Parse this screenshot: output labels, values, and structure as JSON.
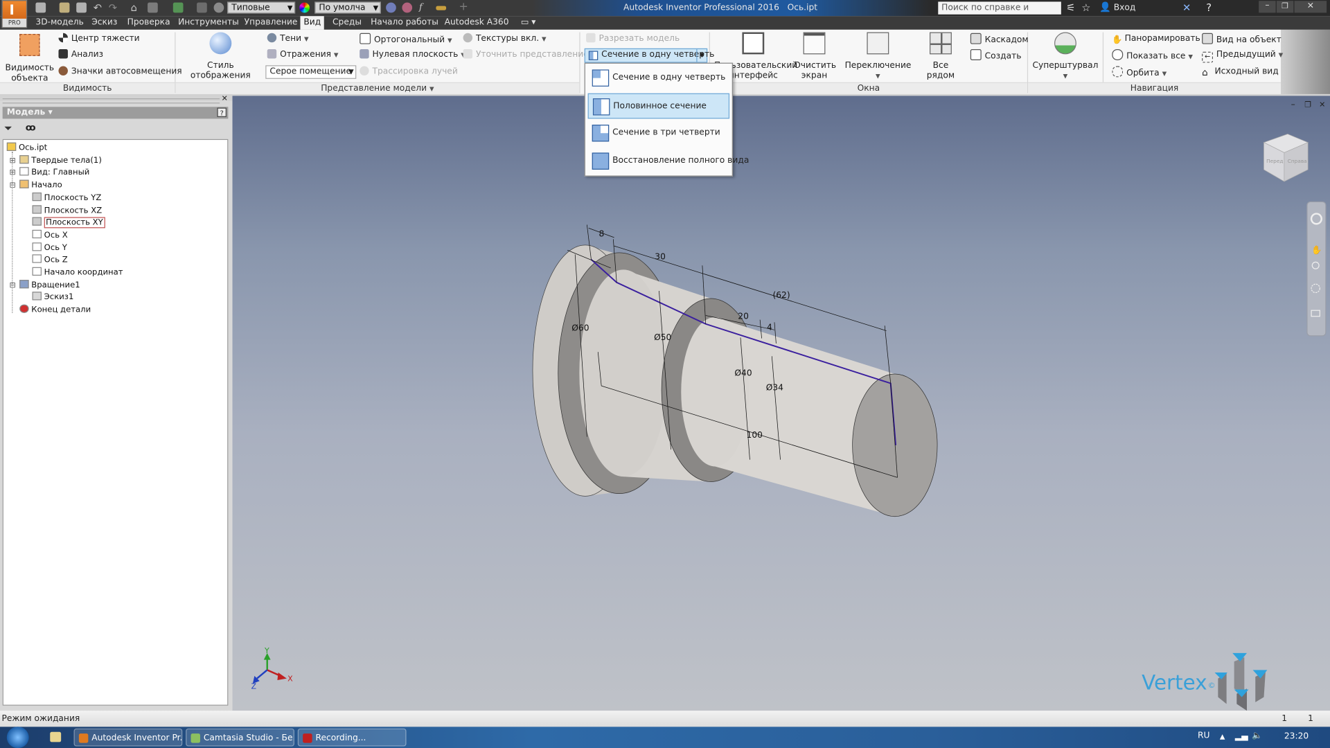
{
  "window": {
    "title": "Autodesk Inventor Professional 2016",
    "document": "Ось.ipt",
    "app_badge": "PRO",
    "search_placeholder": "Поиск по справке и командам...",
    "sign_in": "Вход",
    "appearance_combo": "Типовые",
    "material_combo": "По умолча"
  },
  "tabs": [
    "3D-модель",
    "Эскиз",
    "Проверка",
    "Инструменты",
    "Управление",
    "Вид",
    "Среды",
    "Начало работы",
    "Autodesk A360"
  ],
  "active_tab": "Вид",
  "ribbon": {
    "visibility": {
      "panel_label": "Видимость",
      "object_visibility": [
        "Видимость",
        "объекта"
      ],
      "center_of_gravity": "Центр тяжести",
      "analysis": "Анализ",
      "snap_icons": "Значки автосовмещения"
    },
    "appearance": {
      "panel_label": "Представление модели",
      "visual_style": "Стиль отображения",
      "shadows": "Тени",
      "reflections": "Отражения",
      "lighting_style": "Серое помещение",
      "orthographic": "Ортогональный",
      "ground_plane": "Нулевая плоскость",
      "ray_tracing": "Трассировка лучей",
      "textures": "Текстуры вкл.",
      "refine": "Уточнить представление",
      "slice": "Разрезать модель",
      "section": "Сечение в одну четверть"
    },
    "windows": {
      "panel_label": "Окна",
      "user_interface": [
        "Пользовательский",
        "интерфейс"
      ],
      "clean_screen": [
        "Очистить",
        "экран"
      ],
      "switch": "Переключение",
      "tile": "Все рядом",
      "cascade": "Каскадом",
      "new": "Создать"
    },
    "navigation": {
      "panel_label": "Навигация",
      "full_nav_wheel": "Суперштурвал",
      "pan": "Панорамировать",
      "zoom_all": "Показать все",
      "orbit": "Орбита",
      "look_at": "Вид на объект",
      "previous": "Предыдущий",
      "home_view": "Исходный вид"
    }
  },
  "section_menu": {
    "items": [
      "Сечение в одну четверть",
      "Половинное сечение",
      "Сечение в три четверти",
      "Восстановление полного вида"
    ],
    "highlighted": "Половинное сечение"
  },
  "browser": {
    "title": "Модель",
    "tree": [
      {
        "label": "Ось.ipt",
        "level": 0,
        "icon": "part-icon",
        "expander": ""
      },
      {
        "label": "Твердые тела(1)",
        "level": 1,
        "icon": "solid-bodies-folder-icon",
        "expander": "+"
      },
      {
        "label": "Вид: Главный",
        "level": 1,
        "icon": "view-rep-icon",
        "expander": "+"
      },
      {
        "label": "Начало",
        "level": 1,
        "icon": "folder-open-icon",
        "expander": "-"
      },
      {
        "label": "Плоскость YZ",
        "level": 2,
        "icon": "plane-icon",
        "expander": ""
      },
      {
        "label": "Плоскость XZ",
        "level": 2,
        "icon": "plane-icon",
        "expander": ""
      },
      {
        "label": "Плоскость XY",
        "level": 2,
        "icon": "plane-icon",
        "expander": "",
        "selected": true
      },
      {
        "label": "Ось X",
        "level": 2,
        "icon": "axis-icon",
        "expander": ""
      },
      {
        "label": "Ось Y",
        "level": 2,
        "icon": "axis-icon",
        "expander": ""
      },
      {
        "label": "Ось Z",
        "level": 2,
        "icon": "axis-icon",
        "expander": ""
      },
      {
        "label": "Начало координат",
        "level": 2,
        "icon": "origin-point-icon",
        "expander": ""
      },
      {
        "label": "Вращение1",
        "level": 1,
        "icon": "revolve-icon",
        "expander": "-"
      },
      {
        "label": "Эскиз1",
        "level": 2,
        "icon": "sketch-icon",
        "expander": ""
      },
      {
        "label": "Конец детали",
        "level": 1,
        "icon": "end-of-part-icon",
        "expander": ""
      }
    ]
  },
  "model": {
    "dimensions": {
      "d1": "8",
      "d2": "30",
      "d3": "(62)",
      "d4": "20",
      "d5": "4",
      "dia60": "Ø60",
      "dia50": "Ø50",
      "dia40": "Ø40",
      "dia34": "Ø34",
      "len": "100"
    },
    "triad": {
      "x": "X",
      "y": "Y",
      "z": "Z"
    },
    "viewcube_faces": [
      "Перед",
      "Справа"
    ],
    "watermark": "Vertex"
  },
  "status": {
    "text": "Режим ожидания",
    "count1": "1",
    "count2": "1"
  },
  "taskbar": {
    "items": [
      "Autodesk Inventor Pr...",
      "Camtasia Studio - Бе...",
      "Recording..."
    ],
    "lang": "RU",
    "clock": "23:20"
  },
  "colors": {
    "accent": "#cde6f7",
    "sketch_edge": "#3a1f9e",
    "watermark": "#3aa0d8"
  }
}
